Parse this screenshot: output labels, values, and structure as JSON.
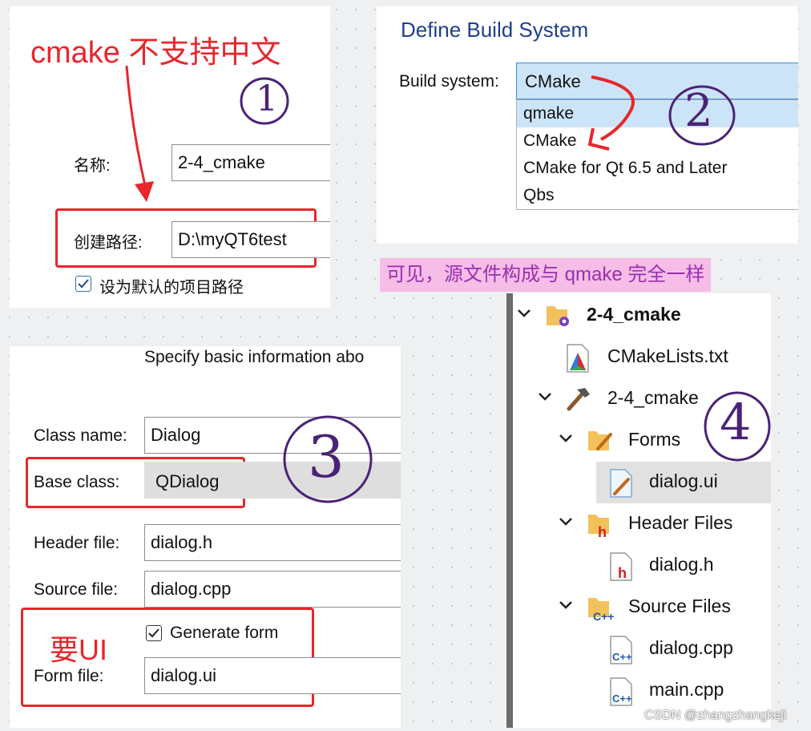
{
  "panel1": {
    "annotation": "cmake 不支持中文",
    "step": "1",
    "name_label": "名称:",
    "name_value": "2-4_cmake",
    "path_label": "创建路径:",
    "path_value": "D:\\myQT6test",
    "default_path_label": "设为默认的项目路径",
    "default_path_checked": true
  },
  "panel2": {
    "title": "Define Build System",
    "build_system_label": "Build system:",
    "selected": "CMake",
    "options": [
      "qmake",
      "CMake",
      "CMake for Qt 6.5 and Later",
      "Qbs"
    ],
    "step": "2"
  },
  "banner": {
    "text": "可见，源文件构成与 qmake 完全一样"
  },
  "panel3": {
    "heading": "Specify basic information abo",
    "class_name_label": "Class name:",
    "class_name_value": "Dialog",
    "base_class_label": "Base class:",
    "base_class_value": "QDialog",
    "header_file_label": "Header file:",
    "header_file_value": "dialog.h",
    "source_file_label": "Source file:",
    "source_file_value": "dialog.cpp",
    "generate_form_label": "Generate form",
    "generate_form_checked": true,
    "form_file_label": "Form file:",
    "form_file_value": "dialog.ui",
    "annotation": "要UI",
    "step": "3"
  },
  "panel4": {
    "project": "2-4_cmake",
    "cmakelists": "CMakeLists.txt",
    "target": "2-4_cmake",
    "forms": "Forms",
    "form_file": "dialog.ui",
    "header_files": "Header Files",
    "header_file": "dialog.h",
    "source_files": "Source Files",
    "source_file_1": "dialog.cpp",
    "source_file_2": "main.cpp",
    "step": "4"
  },
  "watermark": "CSDN @zhangzhangkeji",
  "colors": {
    "annotation_red": "#e8262c",
    "annotation_purple": "#4a2377",
    "banner_bg": "#f6bde6",
    "banner_text": "#9a2fb1",
    "selection_blue": "#cce4f7",
    "title_blue": "#1e3f8f"
  }
}
